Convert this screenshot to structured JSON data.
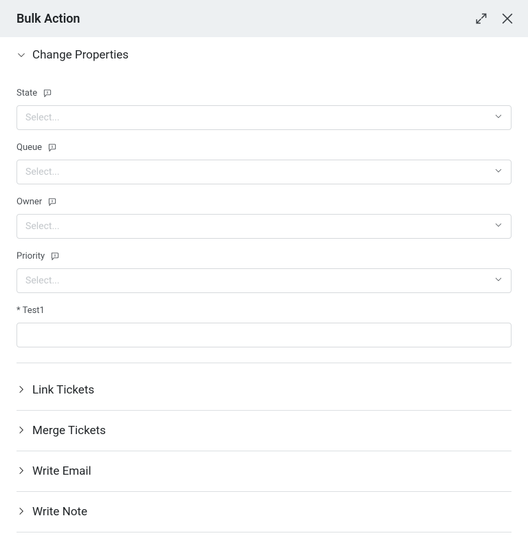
{
  "header": {
    "title": "Bulk Action"
  },
  "sections": {
    "changeProperties": {
      "title": "Change Properties",
      "fields": {
        "state": {
          "label": "State",
          "placeholder": "Select..."
        },
        "queue": {
          "label": "Queue",
          "placeholder": "Select..."
        },
        "owner": {
          "label": "Owner",
          "placeholder": "Select..."
        },
        "priority": {
          "label": "Priority",
          "placeholder": "Select..."
        },
        "test1": {
          "label": "* Test1",
          "value": ""
        }
      }
    },
    "linkTickets": {
      "title": "Link Tickets"
    },
    "mergeTickets": {
      "title": "Merge Tickets"
    },
    "writeEmail": {
      "title": "Write Email"
    },
    "writeNote": {
      "title": "Write Note"
    }
  }
}
